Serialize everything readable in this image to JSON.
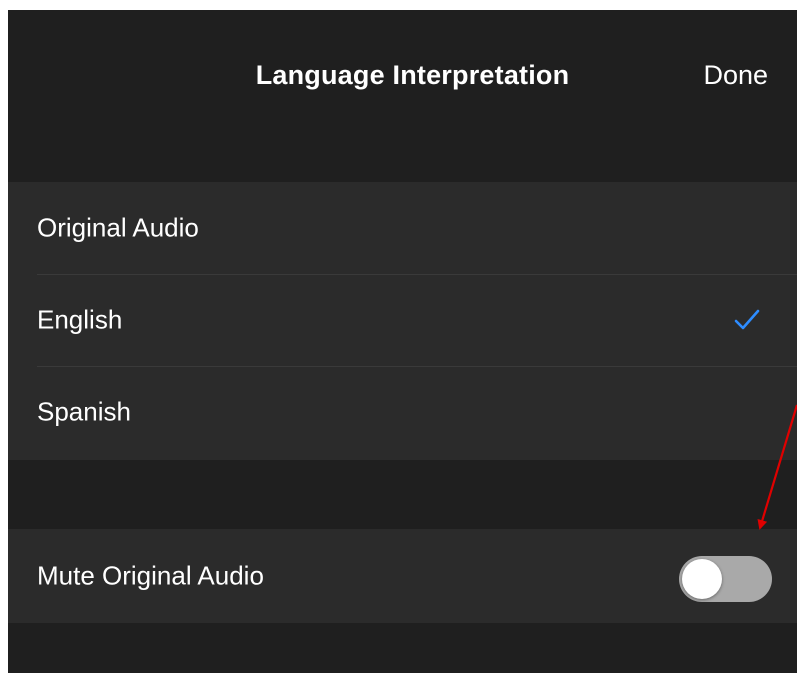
{
  "header": {
    "title": "Language Interpretation",
    "done_label": "Done"
  },
  "languages": {
    "items": [
      {
        "label": "Original Audio",
        "selected": false
      },
      {
        "label": "English",
        "selected": true
      },
      {
        "label": "Spanish",
        "selected": false
      }
    ]
  },
  "mute": {
    "label": "Mute Original Audio",
    "enabled": false
  },
  "colors": {
    "background": "#1f1f1f",
    "row_background": "#2b2b2b",
    "checkmark": "#2d8cff",
    "toggle_off": "#a9a9a9",
    "annotation_arrow": "#e00000"
  }
}
